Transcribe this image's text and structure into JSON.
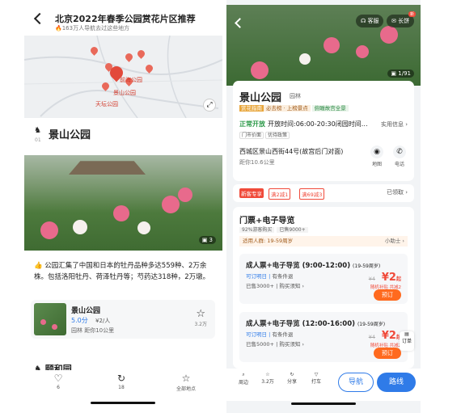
{
  "left": {
    "header": {
      "title": "北京2022年春季公园赏花片区推荐",
      "subtitle": "163万人导航去过这些地方"
    },
    "map": {
      "areas": [
        "前海公园",
        "景山公园",
        "天坛公园"
      ]
    },
    "section": {
      "num": "01",
      "name": "景山公园"
    },
    "photo_count": "3",
    "description": "公园汇集了中国和日本的牡丹品种多达559种、2万余株。包括洛阳牡丹、荷泽牡丹等；芍药达318种，2万墩。",
    "card": {
      "name": "景山公园",
      "score": "5.0分",
      "price": "¥2/人",
      "meta": "园林 距你10公里",
      "star_count": "3.2万"
    },
    "next_section": "颐和园",
    "bottom_bar": [
      {
        "icon": "♡",
        "label": "6"
      },
      {
        "icon": "↻",
        "label": "18"
      },
      {
        "icon": "☆",
        "label": "全部地点"
      }
    ]
  },
  "right": {
    "top": {
      "service": "客服",
      "bar": "长饼",
      "new": "新"
    },
    "hero_count": "1/91",
    "place": {
      "name": "景山公园",
      "type": "园林",
      "rank_a": "赏花指南",
      "rank_b": "必去榜 · 上榜景点",
      "rank_c": "俯瞰故宫全景",
      "open_status": "正常开放",
      "open_time": "开放时间:06:00-20:30闭园时间…",
      "open_more": "实用信息",
      "subtags": [
        "门市价面",
        "优待政策"
      ],
      "address": "西城区景山西街44号(故宫后门对面)",
      "distance": "距你10.6公里",
      "action1": "地图",
      "action2": "电话"
    },
    "coupons": {
      "c1": "新客专享",
      "c2": "满2减1",
      "c3": "满69减3",
      "get": "已领取"
    },
    "tickets": {
      "title": "门票+电子导览",
      "sub1": "92%游客购买",
      "sub2": "已售9000+",
      "crowd": "适用人群: 19-59周岁",
      "crowd_tag": "小助士",
      "items": [
        {
          "name": "成人票+电子导览 (9:00-12:00)",
          "age": "(19-59周岁)",
          "flag": "可订明日",
          "flag2": "有条件退",
          "sold": "已售3000+",
          "notice": "购买须知",
          "orig": "¥4",
          "price": "¥2",
          "sub": "随机补贴 共减2",
          "book": "预订"
        },
        {
          "name": "成人票+电子导览 (12:00-16:00)",
          "age": "(19-59周岁)",
          "flag": "可订明日",
          "flag2": "有条件退",
          "sold": "已售5000+",
          "notice": "购买须知",
          "orig": "¥4",
          "price": "¥2",
          "sub": "随机补贴 共减2",
          "book": "预订"
        }
      ]
    },
    "order": "订单",
    "bottom_bar": [
      {
        "icon": "⌕",
        "label": "周边"
      },
      {
        "icon": "☆",
        "label": "3.2万"
      },
      {
        "icon": "↻",
        "label": "分享"
      },
      {
        "icon": "▽",
        "label": "打车"
      }
    ],
    "nav": "导航",
    "route": "路线"
  }
}
